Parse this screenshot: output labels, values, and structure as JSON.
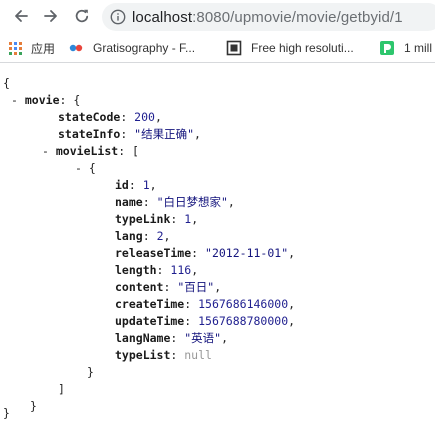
{
  "browser": {
    "url_host": "localhost",
    "url_rest": ":8080/upmovie/movie/getbyid/1"
  },
  "bookmarks": [
    {
      "label": "应用",
      "icon": "apps-grid-icon"
    },
    {
      "label": "Gratisography - F...",
      "icon": "gratisography-icon"
    },
    {
      "label": "Free high resoluti...",
      "icon": "image-frame-icon"
    },
    {
      "label": "1 mill",
      "icon": "pixabay-icon"
    }
  ],
  "json": {
    "open_brace": "{",
    "collapse_toggle": "-",
    "expand_toggle": "-",
    "movie_key": "movie",
    "movie_open": ": {",
    "stateCode_key": "stateCode",
    "stateCode_value": "200",
    "stateInfo_key": "stateInfo",
    "stateInfo_value": "\"结果正确\"",
    "movieList_key": "movieList",
    "movieList_open": ": [",
    "item_open": "{",
    "id_key": "id",
    "id_value": "1",
    "name_key": "name",
    "name_value": "\"白日梦想家\"",
    "typeLink_key": "typeLink",
    "typeLink_value": "1",
    "lang_key": "lang",
    "lang_value": "2",
    "releaseTime_key": "releaseTime",
    "releaseTime_value": "\"2012-11-01\"",
    "length_key": "length",
    "length_value": "116",
    "content_key": "content",
    "content_value": "\"百日\"",
    "createTime_key": "createTime",
    "createTime_value": "1567686146000",
    "updateTime_key": "updateTime",
    "updateTime_value": "1567688780000",
    "langName_key": "langName",
    "langName_value": "\"英语\"",
    "typeList_key": "typeList",
    "typeList_value": "null",
    "colon": ": ",
    "comma": ",",
    "item_close": "}",
    "list_close": "]",
    "movie_close": "}",
    "close_brace": "}"
  },
  "colors": {
    "key": "#1a1a1a",
    "string": "#14147d",
    "null": "#999999",
    "omnibox": "#f1f3f4"
  }
}
